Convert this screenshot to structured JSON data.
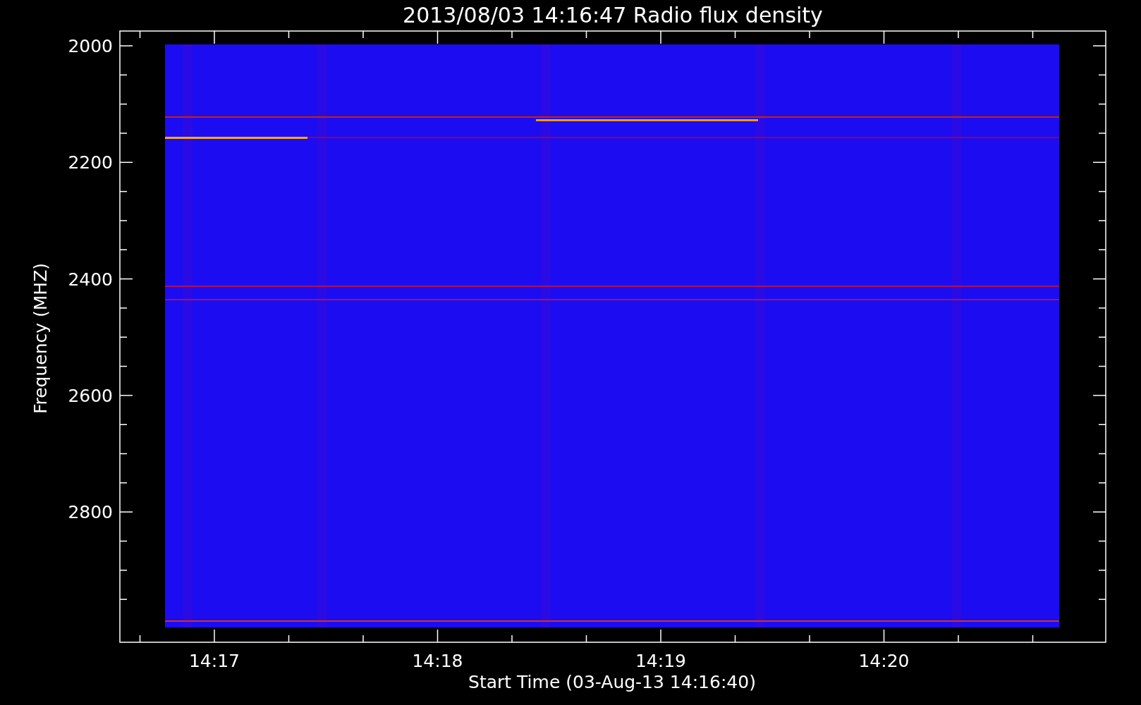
{
  "title": "2013/08/03 14:16:47 Radio flux density",
  "y_axis": {
    "label": "Frequency (MHZ)",
    "ticks": [
      "2000",
      "2200",
      "2400",
      "2600",
      "2800"
    ]
  },
  "x_axis": {
    "label": "Start Time (03-Aug-13 14:16:40)",
    "ticks": [
      "14:17",
      "14:18",
      "14:19",
      "14:20"
    ]
  }
}
